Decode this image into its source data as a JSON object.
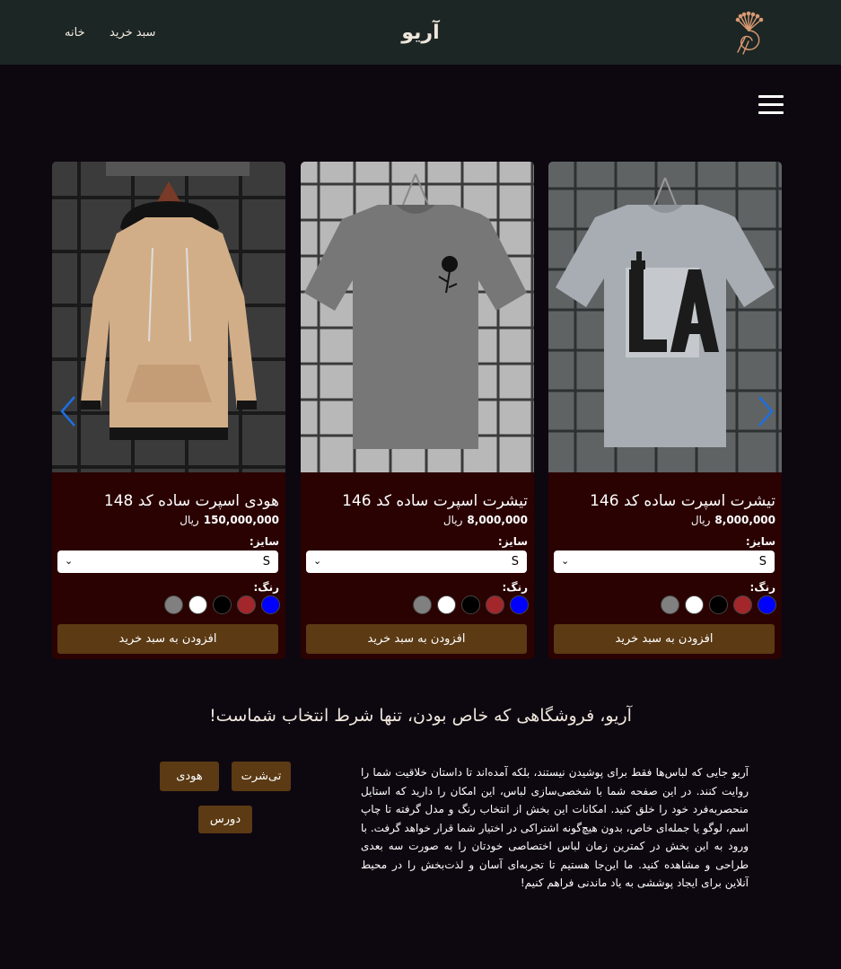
{
  "header": {
    "site_title": "آریو",
    "nav": {
      "home": "خانه",
      "cart": "سبد خرید"
    },
    "logo_icon": "peacock-logo-icon",
    "background": "#1c2624"
  },
  "menu_icon": "hamburger-menu-icon",
  "carousel": {
    "prev_icon": "chevron-left-icon",
    "next_icon": "chevron-right-icon",
    "products": [
      {
        "title": "تیشرت اسپرت ساده کد 146",
        "price": "8,000,000",
        "currency": "ریال",
        "size_label": "سایز:",
        "size_value": "S",
        "color_label": "رنگ:",
        "colors": [
          "#0000ff",
          "#a3262a",
          "#000000",
          "#ffffff",
          "#808080"
        ],
        "add_to_cart": "افزودن به سبد خرید",
        "image": "light-gray-la-tshirt"
      },
      {
        "title": "تیشرت اسپرت ساده کد 146",
        "price": "8,000,000",
        "currency": "ریال",
        "size_label": "سایز:",
        "size_value": "S",
        "color_label": "رنگ:",
        "colors": [
          "#0000ff",
          "#a3262a",
          "#000000",
          "#ffffff",
          "#808080"
        ],
        "add_to_cart": "افزودن به سبد خرید",
        "image": "gray-rose-tshirt"
      },
      {
        "title": "هودی اسپرت ساده کد 148",
        "price": "150,000,000",
        "currency": "ریال",
        "size_label": "سایز:",
        "size_value": "S",
        "color_label": "رنگ:",
        "colors": [
          "#0000ff",
          "#a3262a",
          "#000000",
          "#ffffff",
          "#808080"
        ],
        "add_to_cart": "افزودن به سبد خرید",
        "image": "beige-hoodie"
      }
    ]
  },
  "tagline": "آریو، فروشگاهی که خاص بودن، تنها شرط انتخاب شماست!",
  "about": "آریو جایی که لباس‌ها فقط برای پوشیدن نیستند، بلکه آمده‌اند تا داستان خلاقیت شما را روایت کنند. در این صفحه شما با شخصی‌سازی لباس، این امکان را دارید که استایل منحصربه‌فرد خود را خلق کنید. امکانات این بخش از انتخاب رنگ و مدل گرفته تا چاپ اسم، لوگو یا جمله‌ای خاص، بدون هیچ‌گونه اشتراکی در اختیار شما قرار خواهد گرفت. با ورود به این بخش در کمترین زمان لباس اختصاصی خودتان را به صورت سه بعدی طراحی و مشاهده کنید. ما این‌جا هستیم تا تجربه‌ای آسان و لذت‌بخش را در محیط آنلاین برای ایجاد پوششی به یاد ماندنی فراهم کنیم!",
  "categories": {
    "tshirt": "تی‌شرت",
    "hoodie": "هودی",
    "sweatshirt": "دورس"
  },
  "colors": {
    "page_bg": "#0d0710",
    "card_bg": "#2a0202",
    "button_bg": "#5b3a14",
    "arrow": "#1d6fe0"
  }
}
